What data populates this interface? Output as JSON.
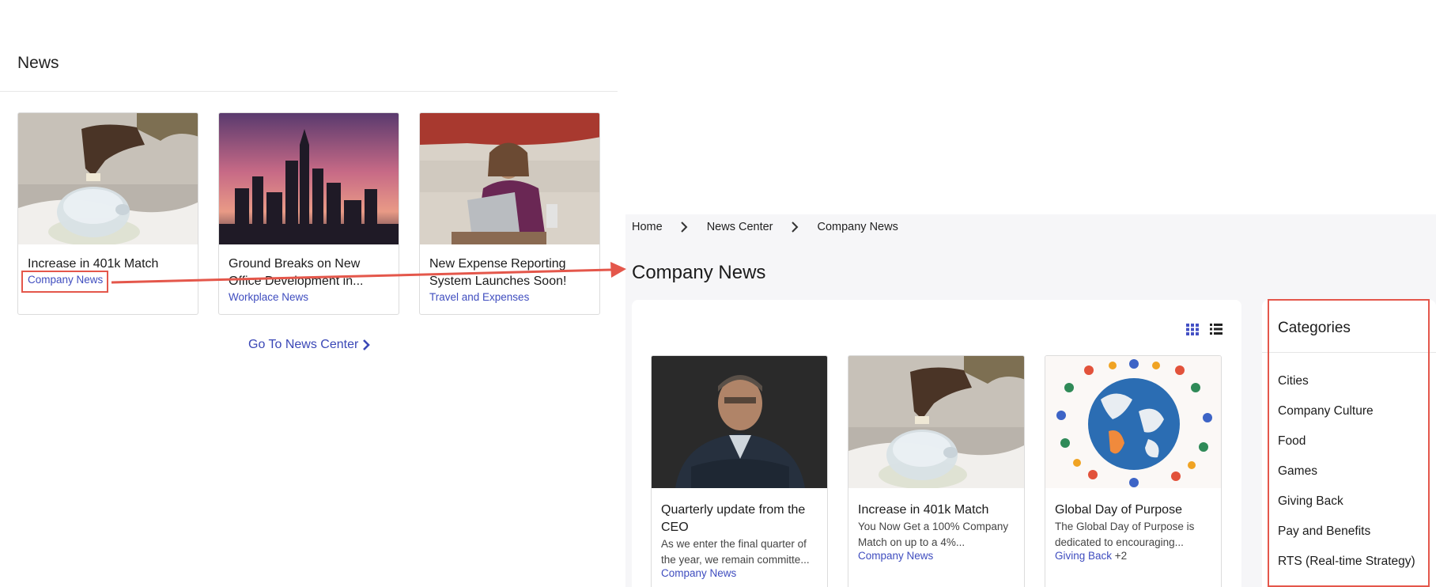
{
  "news_widget": {
    "title": "News",
    "cards": [
      {
        "title": "Increase in 401k Match",
        "category": "Company News",
        "image": "piggy-bank"
      },
      {
        "title": "Ground Breaks on New Office Development in...",
        "category": "Workplace News",
        "image": "city-skyline"
      },
      {
        "title": "New Expense Reporting System Launches Soon!",
        "category": "Travel and Expenses",
        "image": "woman-laptop"
      }
    ],
    "go_to_label": "Go To News Center",
    "go_to_icon": "chevron-right-icon"
  },
  "news_center": {
    "breadcrumb": [
      "Home",
      "News Center",
      "Company News"
    ],
    "title": "Company News",
    "view_icons": [
      "grid-view-icon",
      "list-view-icon"
    ],
    "articles": [
      {
        "title": "Quarterly update from the CEO",
        "excerpt": "As we enter the final quarter of the year, we remain committe...",
        "category": "Company News",
        "more": "",
        "image": "ceo-portrait"
      },
      {
        "title": "Increase in 401k Match",
        "excerpt": "You Now Get a 100% Company Match on up to a 4%...",
        "category": "Company News",
        "more": "",
        "image": "piggy-bank"
      },
      {
        "title": "Global Day of Purpose",
        "excerpt": "The Global Day of Purpose is dedicated to encouraging...",
        "category": "Giving Back",
        "more": "+2",
        "image": "globe-people"
      }
    ],
    "categories_title": "Categories",
    "categories": [
      "Cities",
      "Company Culture",
      "Food",
      "Games",
      "Giving Back",
      "Pay and Benefits",
      "RTS (Real-time Strategy)"
    ]
  },
  "colors": {
    "accent": "#3f4dbf",
    "annotation": "#e4574b",
    "panel_bg": "#f6f6f8"
  }
}
